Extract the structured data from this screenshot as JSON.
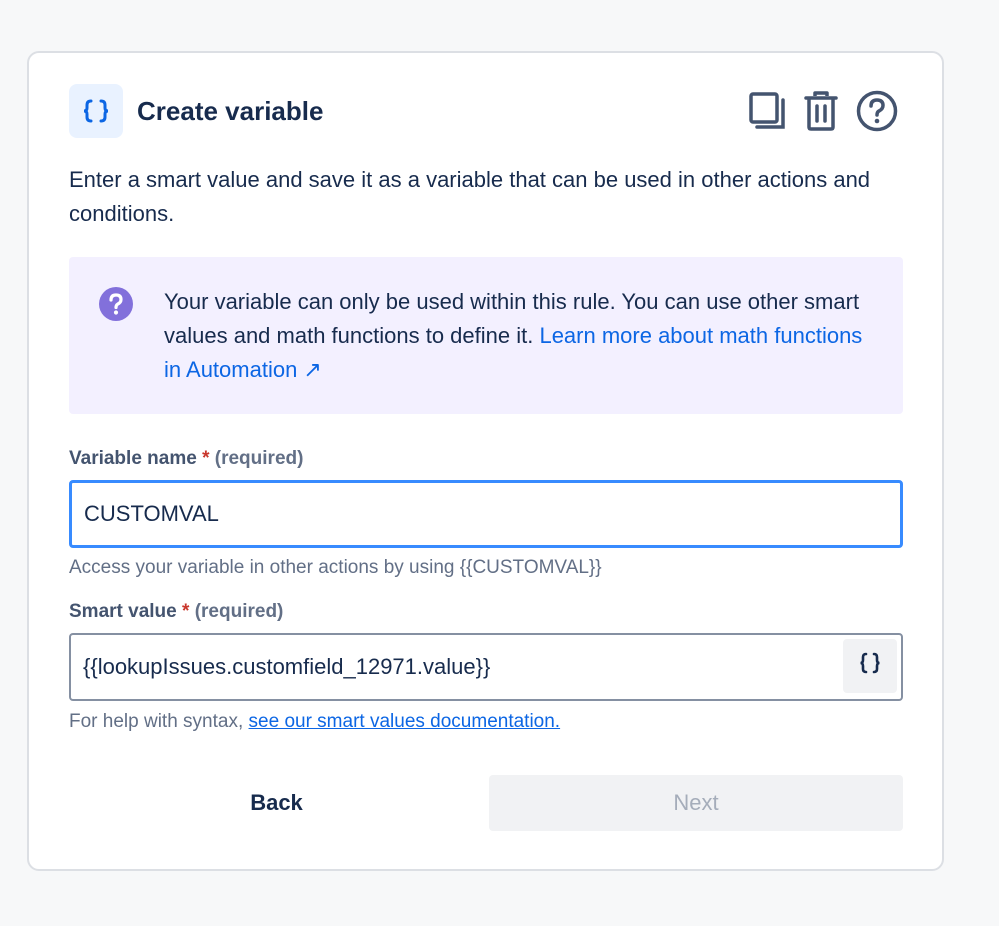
{
  "dialog": {
    "title": "Create variable",
    "header_icon": "curly-braces-icon",
    "actions": [
      "duplicate-icon",
      "trash-icon",
      "help-icon"
    ],
    "description": "Enter a smart value and save it as a variable that can be used in other actions and conditions."
  },
  "info": {
    "icon": "question-icon",
    "text": "Your variable can only be used within this rule. You can use other smart values and math functions to define it. ",
    "link_text": "Learn more about math functions in Automation ↗"
  },
  "variable_name": {
    "label": "Variable name",
    "required_star": "*",
    "required_text": "(required)",
    "value": "CUSTOMVAL",
    "helper": "Access your variable in other actions by using {{CUSTOMVAL}}"
  },
  "smart_value": {
    "label": "Smart value",
    "required_star": "*",
    "required_text": "(required)",
    "value": "{{lookupIssues.customfield_12971.value}}",
    "helper_prefix": "For help with syntax, ",
    "helper_link": "see our smart values documentation.",
    "insert_icon": "curly-braces-icon"
  },
  "footer": {
    "back_label": "Back",
    "next_label": "Next"
  },
  "colors": {
    "accent": "#0c66e4",
    "focus_border": "#388bff",
    "info_bg": "#f3f0ff",
    "info_icon": "#8270db",
    "required": "#c9372c"
  }
}
